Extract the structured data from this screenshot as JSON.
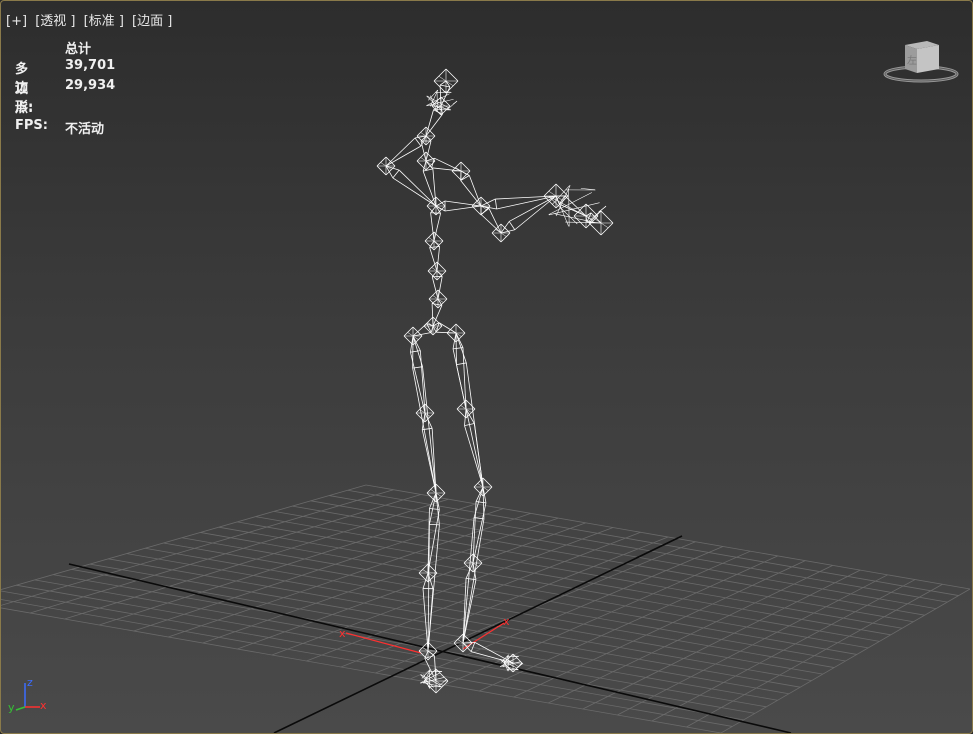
{
  "viewport": {
    "labels": [
      "[+]",
      "[透视 ]",
      "[标准 ]",
      "[边面 ]"
    ]
  },
  "stats": {
    "header": "总计",
    "polygons_label": "多边形:",
    "polygons_value": "39,701",
    "vertices_label": "顶点:",
    "vertices_value": "29,934",
    "fps_label": "FPS:",
    "fps_value": "不活动"
  },
  "viewcube": {
    "face_label": "左"
  },
  "gizmo": {
    "x_label": "x",
    "y_label": "y"
  },
  "axis_tripod": {
    "x": "x",
    "y": "y",
    "z": "z"
  },
  "colors": {
    "grid": "#6a6a6a",
    "grid_major": "#0a0a0a",
    "wire": "#ffffff",
    "axis_x": "#ff3030",
    "axis_y": "#36c236",
    "axis_z": "#3b6cff"
  }
}
